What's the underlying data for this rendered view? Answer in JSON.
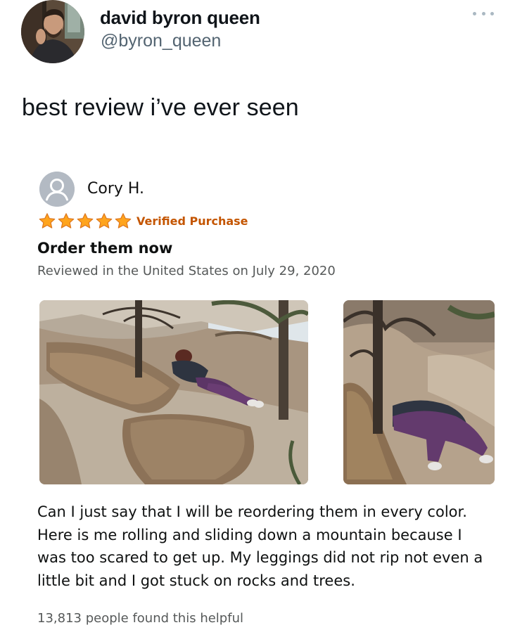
{
  "tweet": {
    "display_name": "david byron queen",
    "handle": "@byron_queen",
    "text": "best review i’ve ever seen",
    "more_icon": "more-horizontal-icon"
  },
  "review": {
    "reviewer": "Cory H.",
    "rating": 5,
    "rating_max": 5,
    "star_color": "#ffa41c",
    "verified_label": "Verified Purchase",
    "verified_color": "#c45500",
    "headline": "Order them now",
    "reviewed_line": "Reviewed in the United States on July 29, 2020",
    "body": "Can I just say that I will be reordering them in every color. Here is me rolling and sliding down a mountain because I was too scared to get up. My leggings did not rip not even a little bit and I got stuck on rocks and trees.",
    "helpful": "13,813 people found this helpful"
  }
}
